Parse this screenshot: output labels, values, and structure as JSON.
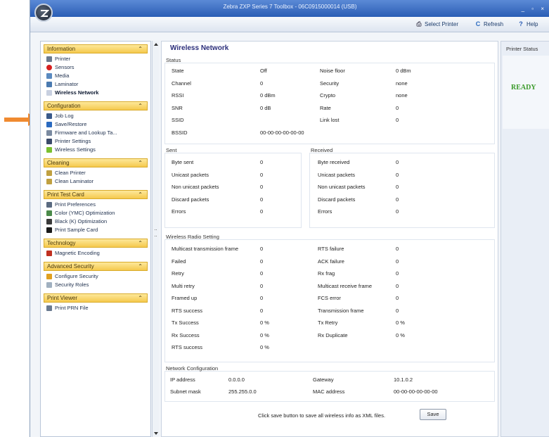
{
  "window": {
    "title": "Zebra ZXP Series 7 Toolbox - 06C0915000014 (USB)",
    "controls": "_ ▫ ×"
  },
  "toolbar": {
    "select_printer": "Select Printer",
    "refresh": "Refresh",
    "help": "Help"
  },
  "sidebar": {
    "sections": [
      {
        "title": "Information",
        "items": [
          {
            "label": "Printer",
            "icon": "printer-icon",
            "color": "#6a7a90"
          },
          {
            "label": "Sensors",
            "icon": "sensor-icon",
            "color": "#d62020"
          },
          {
            "label": "Media",
            "icon": "media-icon",
            "color": "#5a8ac0"
          },
          {
            "label": "Laminator",
            "icon": "laminator-icon",
            "color": "#4a7ab0"
          },
          {
            "label": "Wireless Network",
            "icon": "wireless-icon",
            "color": "#c8d0e0",
            "active": true
          }
        ]
      },
      {
        "title": "Configuration",
        "items": [
          {
            "label": "Job Log",
            "icon": "job-log-icon",
            "color": "#3a5a8a"
          },
          {
            "label": "Save/Restore",
            "icon": "save-restore-icon",
            "color": "#2a6ac0"
          },
          {
            "label": "Firmware and Lookup Ta...",
            "icon": "firmware-icon",
            "color": "#7a8aa0"
          },
          {
            "label": "Printer Settings",
            "icon": "gear-icon",
            "color": "#3a4a6a"
          },
          {
            "label": "Wireless Settings",
            "icon": "wireless-settings-icon",
            "color": "#7ac030"
          }
        ]
      },
      {
        "title": "Cleaning",
        "items": [
          {
            "label": "Clean Printer",
            "icon": "clean-printer-icon",
            "color": "#c0a040"
          },
          {
            "label": "Clean Laminator",
            "icon": "clean-laminator-icon",
            "color": "#c0a040"
          }
        ]
      },
      {
        "title": "Print Test Card",
        "items": [
          {
            "label": "Print Preferences",
            "icon": "print-preferences-icon",
            "color": "#5a6a80"
          },
          {
            "label": "Color (YMC) Optimization",
            "icon": "color-optimization-icon",
            "color": "#4a8a4a"
          },
          {
            "label": "Black (K) Optimization",
            "icon": "black-optimization-icon",
            "color": "#3a3a3a"
          },
          {
            "label": "Print Sample Card",
            "icon": "sample-card-icon",
            "color": "#1a1a1a"
          }
        ]
      },
      {
        "title": "Technology",
        "items": [
          {
            "label": "Magnetic Encoding",
            "icon": "magnet-icon",
            "color": "#c03020"
          }
        ]
      },
      {
        "title": "Advanced Security",
        "items": [
          {
            "label": "Configure Security",
            "icon": "shield-icon",
            "color": "#e0a020"
          },
          {
            "label": "Security Roles",
            "icon": "security-roles-icon",
            "color": "#a0b0c0"
          }
        ]
      },
      {
        "title": "Print Viewer",
        "items": [
          {
            "label": "Print PRN File",
            "icon": "prn-file-icon",
            "color": "#6a7a90"
          }
        ]
      }
    ]
  },
  "main": {
    "title": "Wireless Network",
    "status": {
      "title": "Status",
      "left": [
        {
          "label": "State",
          "value": "Off"
        },
        {
          "label": "Channel",
          "value": "0"
        },
        {
          "label": "RSSI",
          "value": "0 dBm"
        },
        {
          "label": "SNR",
          "value": "0 dB"
        },
        {
          "label": "SSID",
          "value": ""
        },
        {
          "label": "BSSID",
          "value": "00-00-00-00-00-00"
        }
      ],
      "right": [
        {
          "label": "Noise floor",
          "value": "0 dBm"
        },
        {
          "label": "Security",
          "value": "none"
        },
        {
          "label": "Crypto",
          "value": "none"
        },
        {
          "label": "Rate",
          "value": "0"
        },
        {
          "label": "Link lost",
          "value": "0"
        }
      ]
    },
    "sent": {
      "title": "Sent",
      "rows": [
        {
          "label": "Byte sent",
          "value": "0"
        },
        {
          "label": "Unicast packets",
          "value": "0"
        },
        {
          "label": "Non unicast packets",
          "value": "0"
        },
        {
          "label": "Discard packets",
          "value": "0"
        },
        {
          "label": "Errors",
          "value": "0"
        }
      ]
    },
    "received": {
      "title": "Received",
      "rows": [
        {
          "label": "Byte received",
          "value": "0"
        },
        {
          "label": "Unicast packets",
          "value": "0"
        },
        {
          "label": "Non unicast packets",
          "value": "0"
        },
        {
          "label": "Discard packets",
          "value": "0"
        },
        {
          "label": "Errors",
          "value": "0"
        }
      ]
    },
    "radio": {
      "title": "Wireless Radio Setting",
      "left": [
        {
          "label": "Multicast transmission frame",
          "value": "0"
        },
        {
          "label": "Failed",
          "value": "0"
        },
        {
          "label": "Retry",
          "value": "0"
        },
        {
          "label": "Multi retry",
          "value": "0"
        },
        {
          "label": "Framed up",
          "value": "0"
        },
        {
          "label": "RTS success",
          "value": "0"
        },
        {
          "label": "Tx Success",
          "value": "0 %"
        },
        {
          "label": "Rx Success",
          "value": "0 %"
        },
        {
          "label": "RTS success",
          "value": "0 %"
        }
      ],
      "right": [
        {
          "label": "RTS failure",
          "value": "0"
        },
        {
          "label": "ACK failure",
          "value": "0"
        },
        {
          "label": "Rx frag",
          "value": "0"
        },
        {
          "label": "Multicast receive frame",
          "value": "0"
        },
        {
          "label": "FCS error",
          "value": "0"
        },
        {
          "label": "Transmission frame",
          "value": "0"
        },
        {
          "label": "Tx Retry",
          "value": "0 %"
        },
        {
          "label": "Rx Duplicate",
          "value": "0 %"
        }
      ]
    },
    "network": {
      "title": "Network Configuration",
      "ip_label": "IP address",
      "ip_value": "0.0.0.0",
      "mask_label": "Subnet mask",
      "mask_value": "255.255.0.0",
      "gw_label": "Gateway",
      "gw_value": "10.1.0.2",
      "mac_label": "MAC address",
      "mac_value": "00-00-00-00-00-00"
    },
    "save_note": "Click save button to save all wireless info as XML files.",
    "save_label": "Save"
  },
  "printer_status": {
    "title": "Printer Status",
    "value": "READY",
    "value_color": "#3a9a2a"
  },
  "annotation": {
    "arrow_color": "#f08a30"
  }
}
